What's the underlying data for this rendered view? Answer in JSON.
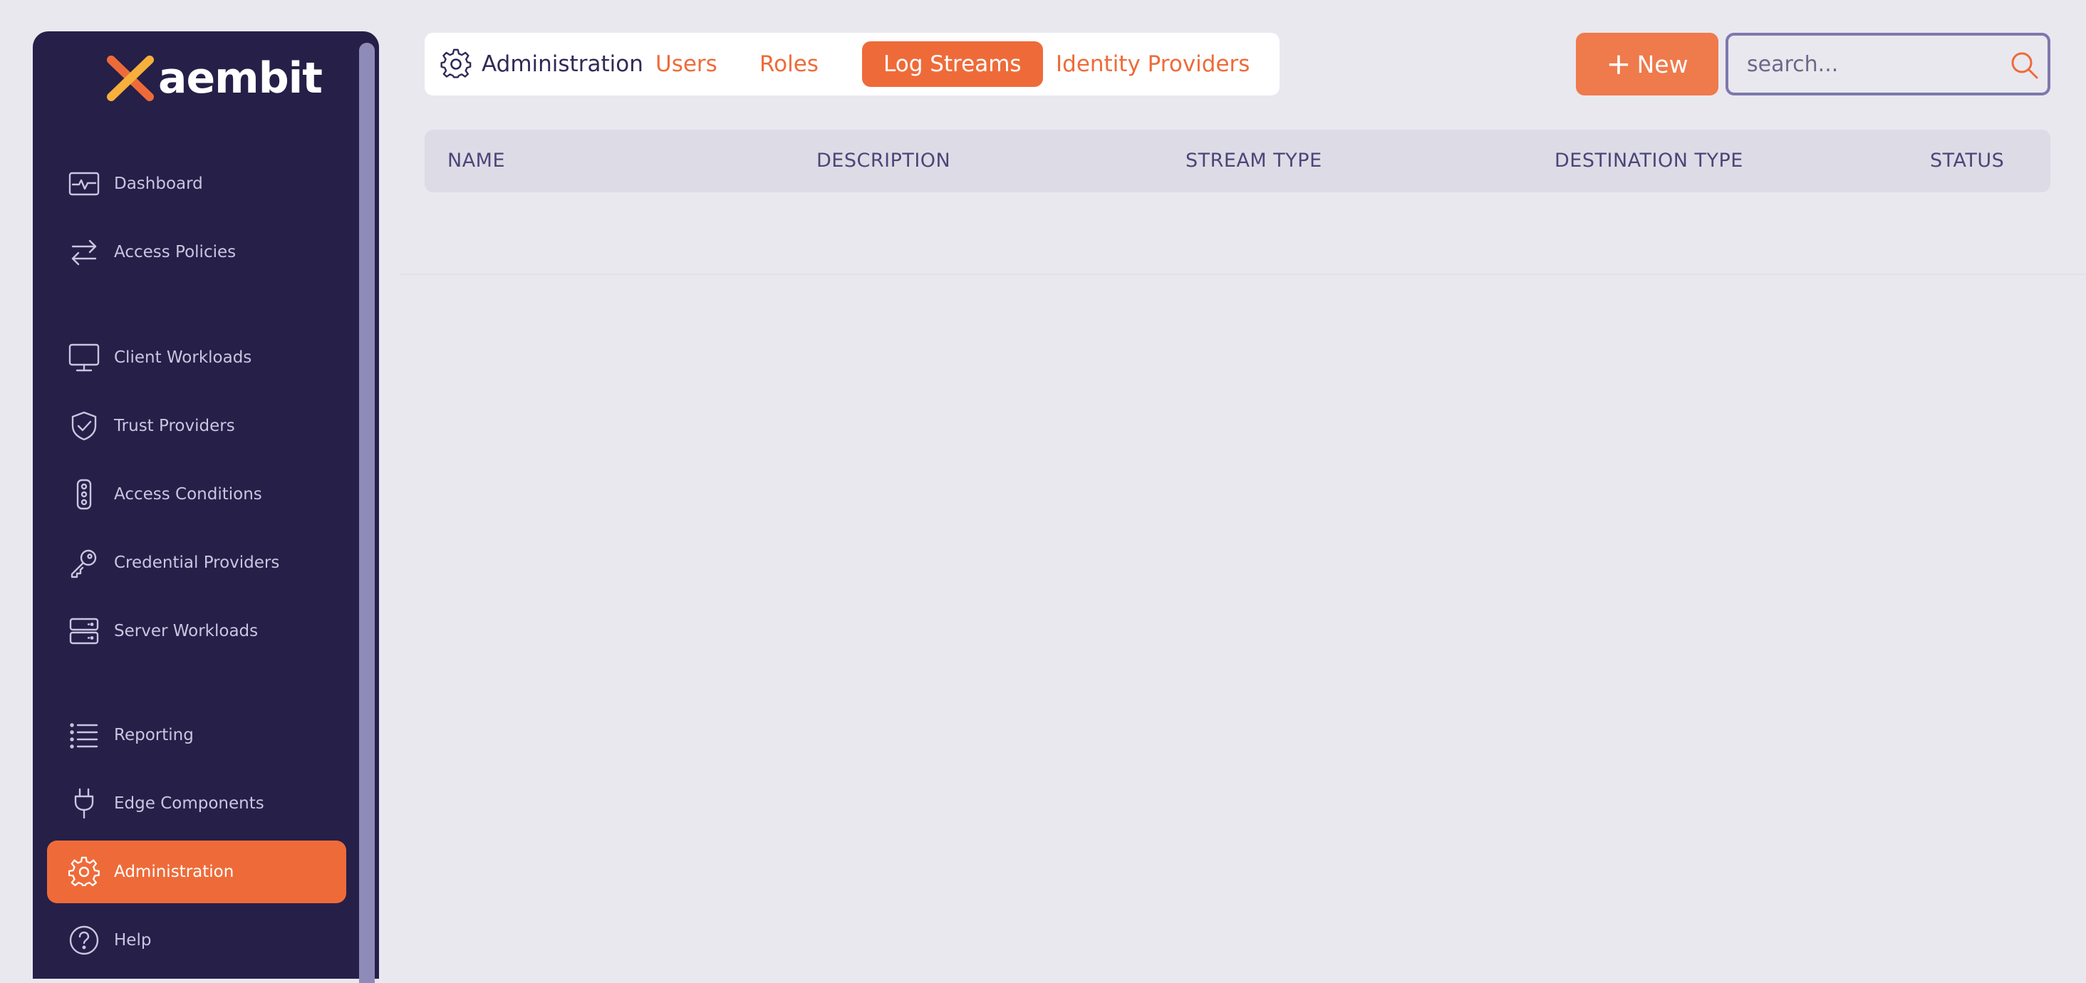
{
  "brand": {
    "logo_text": "aembit",
    "accent_color": "#ee6b39",
    "sidebar_color": "#261f48"
  },
  "sidebar": {
    "items": [
      {
        "label": "Dashboard",
        "icon": "dashboard-icon"
      },
      {
        "label": "Access Policies",
        "icon": "arrows-swap-icon"
      },
      {
        "label": "Client Workloads",
        "icon": "monitor-icon"
      },
      {
        "label": "Trust Providers",
        "icon": "shield-check-icon"
      },
      {
        "label": "Access Conditions",
        "icon": "traffic-light-icon"
      },
      {
        "label": "Credential Providers",
        "icon": "key-icon"
      },
      {
        "label": "Server Workloads",
        "icon": "server-icon"
      },
      {
        "label": "Reporting",
        "icon": "list-icon"
      },
      {
        "label": "Edge Components",
        "icon": "plug-icon"
      },
      {
        "label": "Administration",
        "icon": "gear-icon",
        "active": true
      },
      {
        "label": "Help",
        "icon": "help-icon"
      }
    ]
  },
  "header": {
    "section_title": "Administration",
    "tabs": [
      {
        "label": "Users"
      },
      {
        "label": "Roles"
      },
      {
        "label": "Log Streams",
        "active": true
      },
      {
        "label": "Identity Providers"
      }
    ],
    "new_button_label": "New",
    "search_placeholder": "search..."
  },
  "table": {
    "columns": [
      "NAME",
      "DESCRIPTION",
      "STREAM TYPE",
      "DESTINATION TYPE",
      "STATUS"
    ],
    "rows": []
  }
}
